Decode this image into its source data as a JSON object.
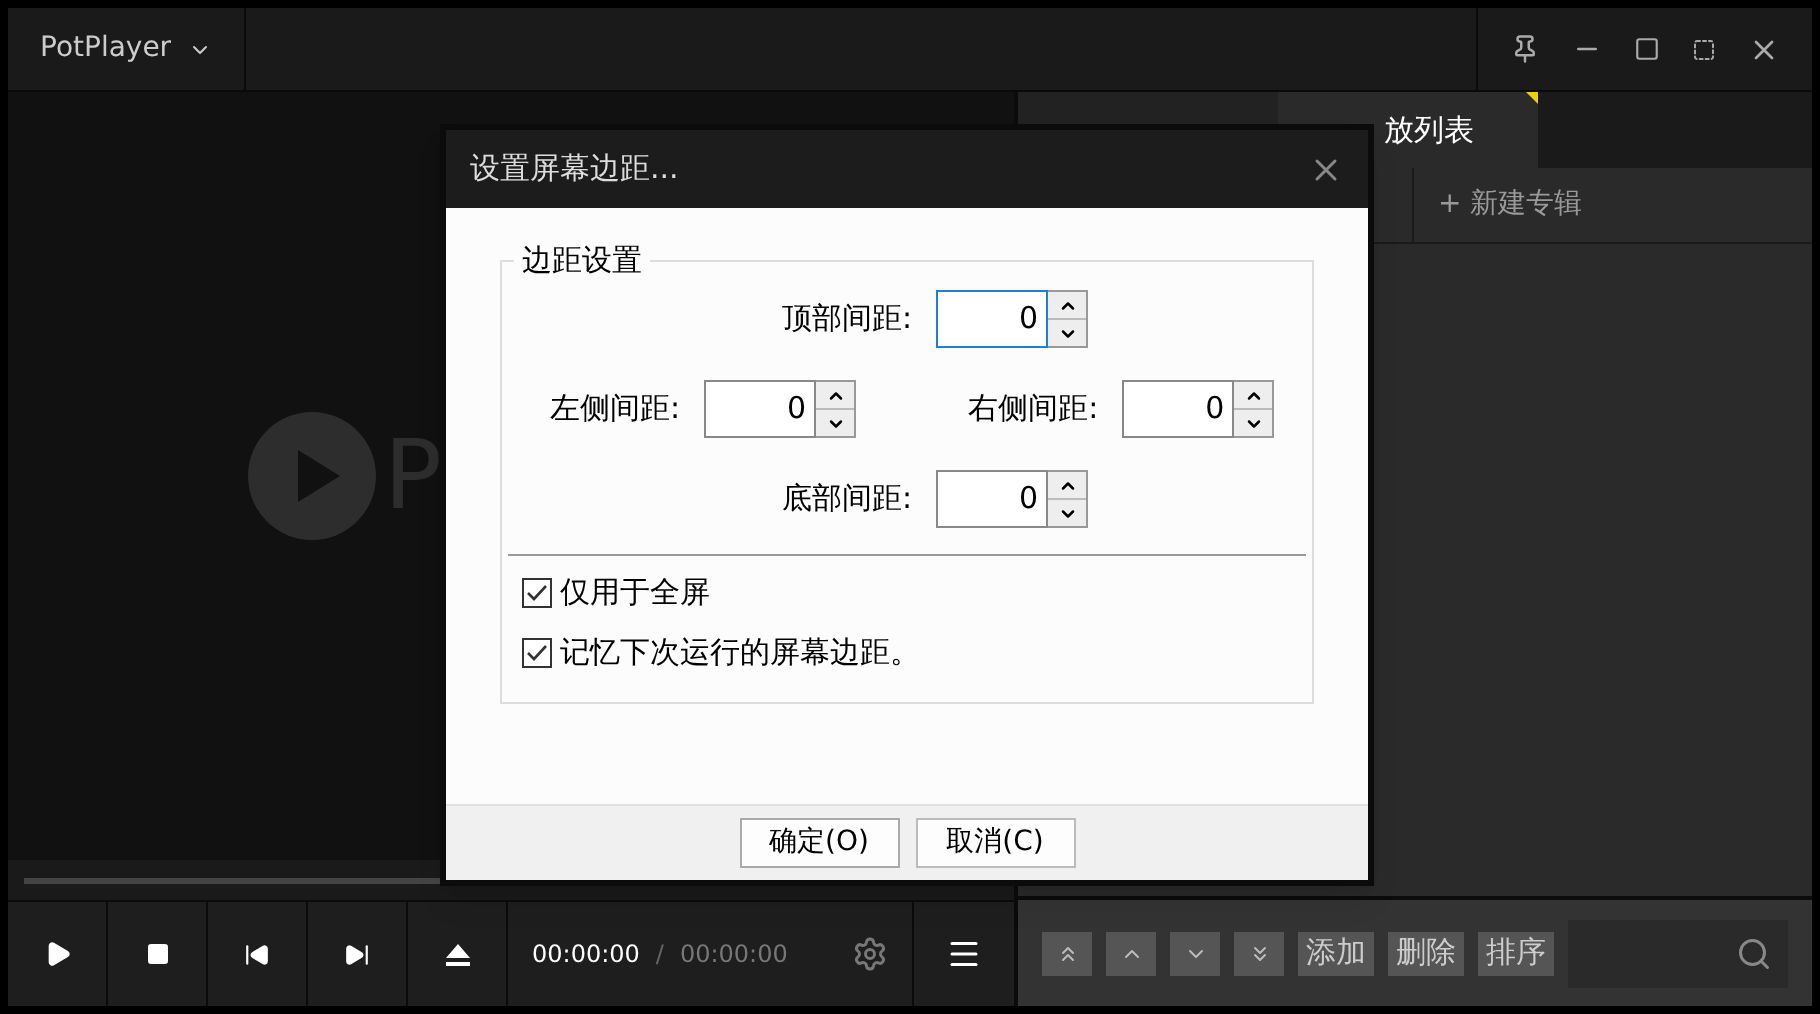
{
  "app": {
    "title": "PotPlayer",
    "logo_text": "P"
  },
  "playlist": {
    "tabs": [
      {
        "selected": false
      },
      {
        "label": "放列表",
        "selected": true
      }
    ],
    "new_album": "+ 新建专辑",
    "buttons": [
      "添加",
      "删除",
      "排序"
    ]
  },
  "controls": {
    "current_time": "00:00:00",
    "separator": "/",
    "total_time": "00:00:00",
    "seek": {
      "level": 0
    }
  },
  "dialog": {
    "title": "设置屏幕边距...",
    "group_title": "边距设置",
    "fields": [
      {
        "label": "顶部间距:",
        "value": "0",
        "focused": true
      },
      {
        "label": "左侧间距:",
        "value": "0",
        "focused": false
      },
      {
        "label": "右侧间距:",
        "value": "0",
        "focused": false
      },
      {
        "label": "底部间距:",
        "value": "0",
        "focused": false
      }
    ],
    "checkboxes": [
      {
        "label": "仅用于全屏",
        "checked": true
      },
      {
        "label": "记忆下次运行的屏幕边距。",
        "checked": true
      }
    ],
    "buttons": [
      {
        "label": "确定(O)",
        "kind": "ok"
      },
      {
        "label": "取消(C)",
        "kind": "cancel"
      }
    ]
  }
}
